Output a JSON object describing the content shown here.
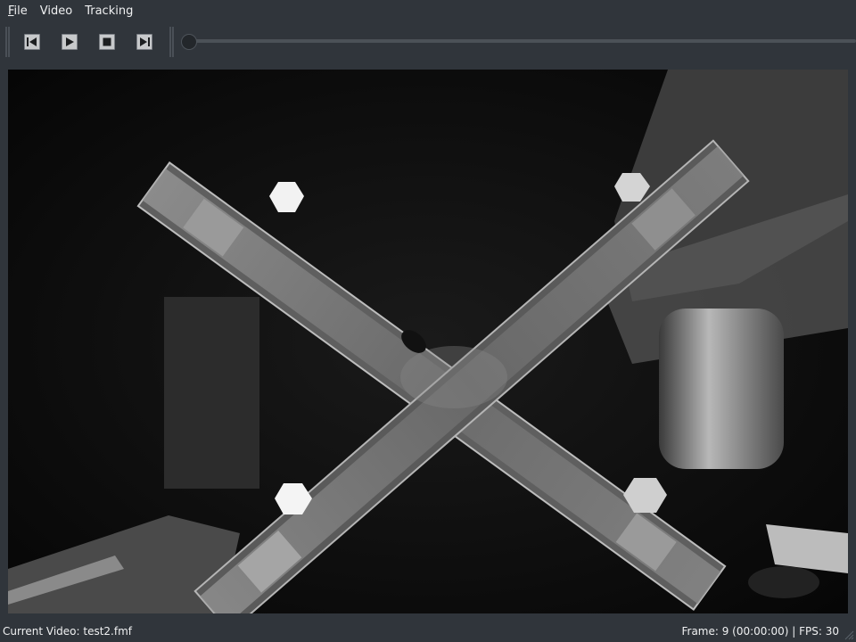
{
  "menubar": {
    "items": [
      {
        "mnemonic": "F",
        "rest": "ile"
      },
      {
        "mnemonic": "",
        "rest": "Video"
      },
      {
        "mnemonic": "",
        "rest": "Tracking"
      }
    ]
  },
  "toolbar": {
    "buttons": [
      "step-back-icon",
      "play-icon",
      "stop-icon",
      "step-forward-icon"
    ],
    "seek_position": 0
  },
  "status": {
    "current_video_label": "Current Video: test2.fmf",
    "frame_info": "Frame: 9 (00:00:00) | FPS: 30"
  },
  "colors": {
    "background": "#30353b",
    "button_face": "#c7c9cb",
    "video_background": "#0b0b0c"
  }
}
